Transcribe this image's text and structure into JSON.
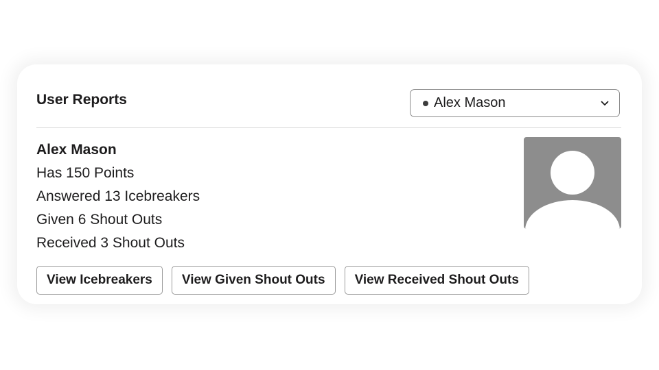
{
  "header": {
    "title": "User Reports"
  },
  "user_select": {
    "selected_value": "Alex Mason",
    "status": "online",
    "icon": "chevron-down-icon"
  },
  "profile": {
    "name": "Alex Mason",
    "stats": [
      "Has 150 Points",
      "Answered 13 Icebreakers",
      "Given 6 Shout Outs",
      "Received 3 Shout Outs"
    ],
    "avatar_icon": "default-avatar-icon"
  },
  "actions": {
    "view_icebreakers": "View Icebreakers",
    "view_given": "View Given Shout Outs",
    "view_received": "View Received Shout Outs"
  }
}
